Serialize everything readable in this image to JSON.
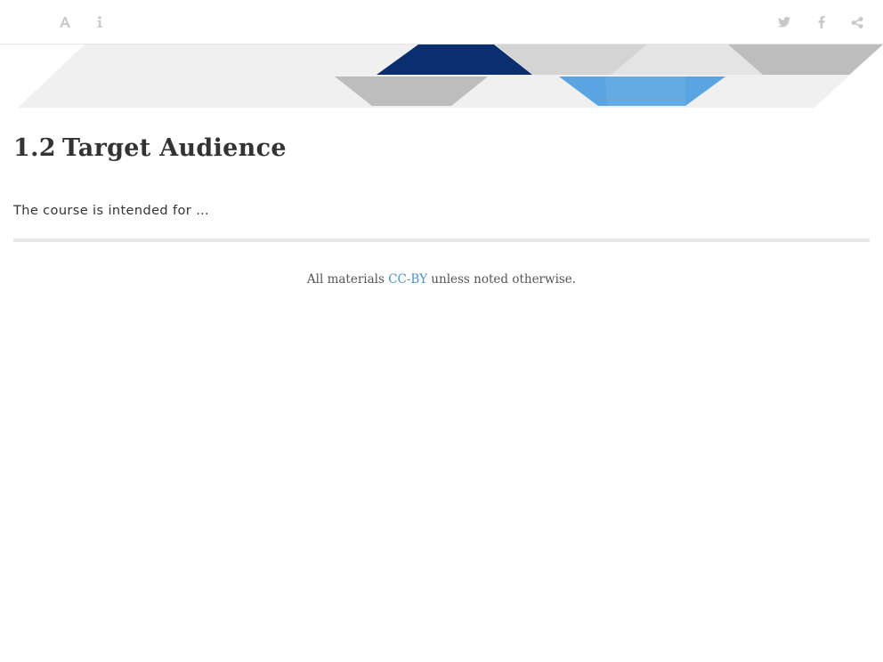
{
  "toolbar": {
    "left_icons": [
      "font-settings-icon",
      "info-icon"
    ],
    "right_icons": [
      "twitter-icon",
      "facebook-icon",
      "share-icon"
    ],
    "icon_color": "#c8c8c8"
  },
  "banner": {
    "colors": {
      "dark_blue": "#0a2e6e",
      "light_blue": "#5aa5e1",
      "gray": "#bdbdbd",
      "light_gray": "#f0f0f0"
    }
  },
  "section": {
    "number": "1.2",
    "title": "Target Audience"
  },
  "body": {
    "paragraph": "The course is intended for …"
  },
  "footer": {
    "prefix": "All materials ",
    "license_link": "CC-BY",
    "suffix": " unless noted otherwise.",
    "link_color": "#4a90c9"
  }
}
